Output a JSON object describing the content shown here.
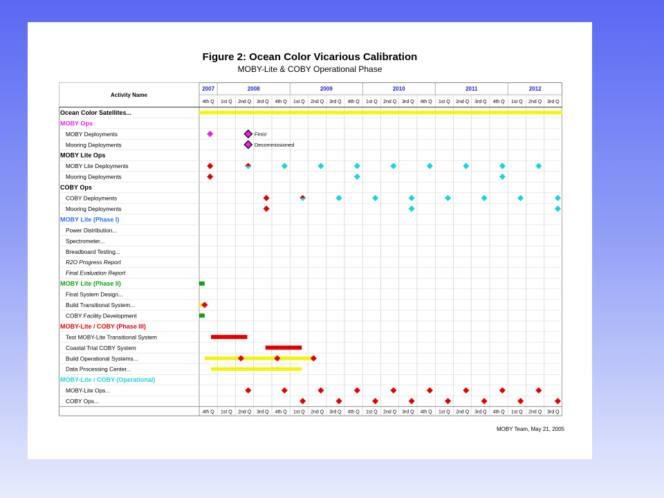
{
  "chart_title": "Figure 2:  Ocean Color Vicarious Calibration",
  "chart_subtitle": "MOBY-Lite & COBY Operational Phase",
  "footer": "MOBY Team, May 21, 2005",
  "chart_data": {
    "type": "gantt",
    "activity_header": "Activity Name",
    "years": [
      {
        "label": "2007",
        "quarters": 1
      },
      {
        "label": "2008",
        "quarters": 4
      },
      {
        "label": "2009",
        "quarters": 4
      },
      {
        "label": "2010",
        "quarters": 4
      },
      {
        "label": "2011",
        "quarters": 4
      },
      {
        "label": "2012",
        "quarters": 3
      }
    ],
    "quarters": [
      "4th Q",
      "1st Q",
      "2nd Q",
      "3rd Q",
      "4th Q",
      "1st Q",
      "2nd Q",
      "3rd Q",
      "4th Q",
      "1st Q",
      "2nd Q",
      "3rd Q",
      "4th Q",
      "1st Q",
      "2nd Q",
      "3rd Q",
      "4th Q",
      "1st Q",
      "2nd Q",
      "3rd Q"
    ],
    "colors": {
      "yellow": "#f5f500",
      "red": "#e50000",
      "cyan": "#19d4dc",
      "magenta": "#ee1ee6",
      "green": "#11a011",
      "blue": "#2b6ff0",
      "year": "#1a1ad8"
    },
    "rows": [
      {
        "label": "Ocean Color Satellites...",
        "style": "bold-black",
        "bars": [
          {
            "start": 0.0,
            "end": 20.0,
            "color": "yellow"
          }
        ]
      },
      {
        "label": "MOBY Ops",
        "style": "head",
        "color": "magenta"
      },
      {
        "label": "MOBY Deployments",
        "style": "item",
        "marks": [
          {
            "q": 0.6,
            "color": "magenta",
            "shape": "diamond"
          },
          {
            "q": 2.7,
            "color": "magenta",
            "shape": "diamond-outlined",
            "note": "Finis!"
          }
        ]
      },
      {
        "label": "Mooring Deployments",
        "style": "item",
        "marks": [
          {
            "q": 2.7,
            "color": "magenta",
            "shape": "diamond-outlined",
            "note": "Decommissioned"
          }
        ]
      },
      {
        "label": "MOBY Lite Ops",
        "style": "head",
        "color": "black"
      },
      {
        "label": "MOBY Lite Deployments",
        "style": "item",
        "marks": [
          {
            "q": 0.6,
            "color": "red",
            "shape": "diamond"
          },
          {
            "q": 2.7,
            "color": "red",
            "shape": "split"
          },
          {
            "q": 4.7,
            "color": "cyan",
            "shape": "diamond"
          },
          {
            "q": 6.7,
            "color": "cyan",
            "shape": "diamond"
          },
          {
            "q": 8.7,
            "color": "cyan",
            "shape": "diamond"
          },
          {
            "q": 10.7,
            "color": "cyan",
            "shape": "diamond"
          },
          {
            "q": 12.7,
            "color": "cyan",
            "shape": "diamond"
          },
          {
            "q": 14.7,
            "color": "cyan",
            "shape": "diamond"
          },
          {
            "q": 16.7,
            "color": "cyan",
            "shape": "diamond"
          },
          {
            "q": 18.7,
            "color": "cyan",
            "shape": "diamond"
          }
        ]
      },
      {
        "label": "Mooring Deployments",
        "style": "item",
        "marks": [
          {
            "q": 0.6,
            "color": "red",
            "shape": "diamond"
          },
          {
            "q": 8.7,
            "color": "cyan",
            "shape": "diamond"
          },
          {
            "q": 16.7,
            "color": "cyan",
            "shape": "diamond"
          }
        ]
      },
      {
        "label": "COBY Ops",
        "style": "head",
        "color": "black"
      },
      {
        "label": "COBY Deployments",
        "style": "item",
        "marks": [
          {
            "q": 3.7,
            "color": "red",
            "shape": "diamond"
          },
          {
            "q": 5.7,
            "color": "red",
            "shape": "split"
          },
          {
            "q": 7.7,
            "color": "cyan",
            "shape": "diamond"
          },
          {
            "q": 9.7,
            "color": "cyan",
            "shape": "diamond"
          },
          {
            "q": 11.7,
            "color": "cyan",
            "shape": "diamond"
          },
          {
            "q": 13.7,
            "color": "cyan",
            "shape": "diamond"
          },
          {
            "q": 15.7,
            "color": "cyan",
            "shape": "diamond"
          },
          {
            "q": 17.7,
            "color": "cyan",
            "shape": "diamond"
          },
          {
            "q": 19.75,
            "color": "cyan",
            "shape": "diamond"
          }
        ]
      },
      {
        "label": "Mooring Deployments",
        "style": "item",
        "marks": [
          {
            "q": 3.7,
            "color": "red",
            "shape": "diamond"
          },
          {
            "q": 11.7,
            "color": "cyan",
            "shape": "diamond"
          },
          {
            "q": 19.75,
            "color": "cyan",
            "shape": "diamond"
          }
        ]
      },
      {
        "label": "MOBY Lite (Phase I)",
        "style": "head",
        "color": "blue"
      },
      {
        "label": "Power Distribution...",
        "style": "item"
      },
      {
        "label": "Spectrometer...",
        "style": "item"
      },
      {
        "label": "Breadboard Testing...",
        "style": "item"
      },
      {
        "label": "R2O Progress Report",
        "style": "italic"
      },
      {
        "label": "Final Evaluation Report",
        "style": "italic"
      },
      {
        "label": "MOBY Lite (Phase II)",
        "style": "head",
        "color": "green",
        "bars": [
          {
            "start": 0.0,
            "end": 0.3,
            "color": "green"
          }
        ]
      },
      {
        "label": "Final System Design...",
        "style": "item"
      },
      {
        "label": "Build Transitional System...",
        "style": "item",
        "bars": [
          {
            "start": 0.0,
            "end": 0.2,
            "color": "yellow"
          }
        ],
        "marks": [
          {
            "q": 0.3,
            "color": "red",
            "shape": "diamond"
          }
        ]
      },
      {
        "label": "COBY Facility Development",
        "style": "item",
        "bars": [
          {
            "start": 0.0,
            "end": 0.3,
            "color": "green"
          }
        ]
      },
      {
        "label": "MOBY-Lite / COBY (Phase III)",
        "style": "head",
        "color": "red"
      },
      {
        "label": "Test MOBY-Lite Transitional System",
        "style": "item",
        "bars": [
          {
            "start": 0.65,
            "end": 2.65,
            "color": "red"
          }
        ]
      },
      {
        "label": "Coastal Trial COBY System",
        "style": "item",
        "bars": [
          {
            "start": 3.65,
            "end": 5.65,
            "color": "red"
          }
        ]
      },
      {
        "label": "Build Operational Systems...",
        "style": "item",
        "bars": [
          {
            "start": 0.3,
            "end": 6.3,
            "color": "yellow"
          }
        ],
        "marks": [
          {
            "q": 2.3,
            "color": "red",
            "shape": "diamond"
          },
          {
            "q": 4.3,
            "color": "red",
            "shape": "diamond"
          },
          {
            "q": 6.3,
            "color": "red",
            "shape": "diamond"
          }
        ]
      },
      {
        "label": "Data Processing Center...",
        "style": "item",
        "bars": [
          {
            "start": 0.65,
            "end": 5.65,
            "color": "yellow"
          }
        ]
      },
      {
        "label": "MOBY-Lite / COBY (Operational)",
        "style": "head",
        "color": "cyan"
      },
      {
        "label": "MOBY-Lite Ops...",
        "style": "item",
        "marks": [
          {
            "q": 2.7,
            "color": "red",
            "shape": "diamond"
          },
          {
            "q": 4.7,
            "color": "red",
            "shape": "diamond"
          },
          {
            "q": 6.7,
            "color": "red",
            "shape": "diamond"
          },
          {
            "q": 8.7,
            "color": "red",
            "shape": "diamond"
          },
          {
            "q": 10.7,
            "color": "red",
            "shape": "diamond"
          },
          {
            "q": 12.7,
            "color": "red",
            "shape": "diamond"
          },
          {
            "q": 14.7,
            "color": "red",
            "shape": "diamond"
          },
          {
            "q": 16.7,
            "color": "red",
            "shape": "diamond"
          },
          {
            "q": 18.7,
            "color": "red",
            "shape": "diamond"
          }
        ]
      },
      {
        "label": "COBY Ops...",
        "style": "item",
        "marks": [
          {
            "q": 5.7,
            "color": "red",
            "shape": "diamond"
          },
          {
            "q": 7.7,
            "color": "red",
            "shape": "diamond"
          },
          {
            "q": 9.7,
            "color": "red",
            "shape": "diamond"
          },
          {
            "q": 11.7,
            "color": "red",
            "shape": "diamond"
          },
          {
            "q": 13.7,
            "color": "red",
            "shape": "diamond"
          },
          {
            "q": 15.7,
            "color": "red",
            "shape": "diamond"
          },
          {
            "q": 17.7,
            "color": "red",
            "shape": "diamond"
          },
          {
            "q": 19.75,
            "color": "red",
            "shape": "diamond"
          }
        ]
      }
    ]
  }
}
